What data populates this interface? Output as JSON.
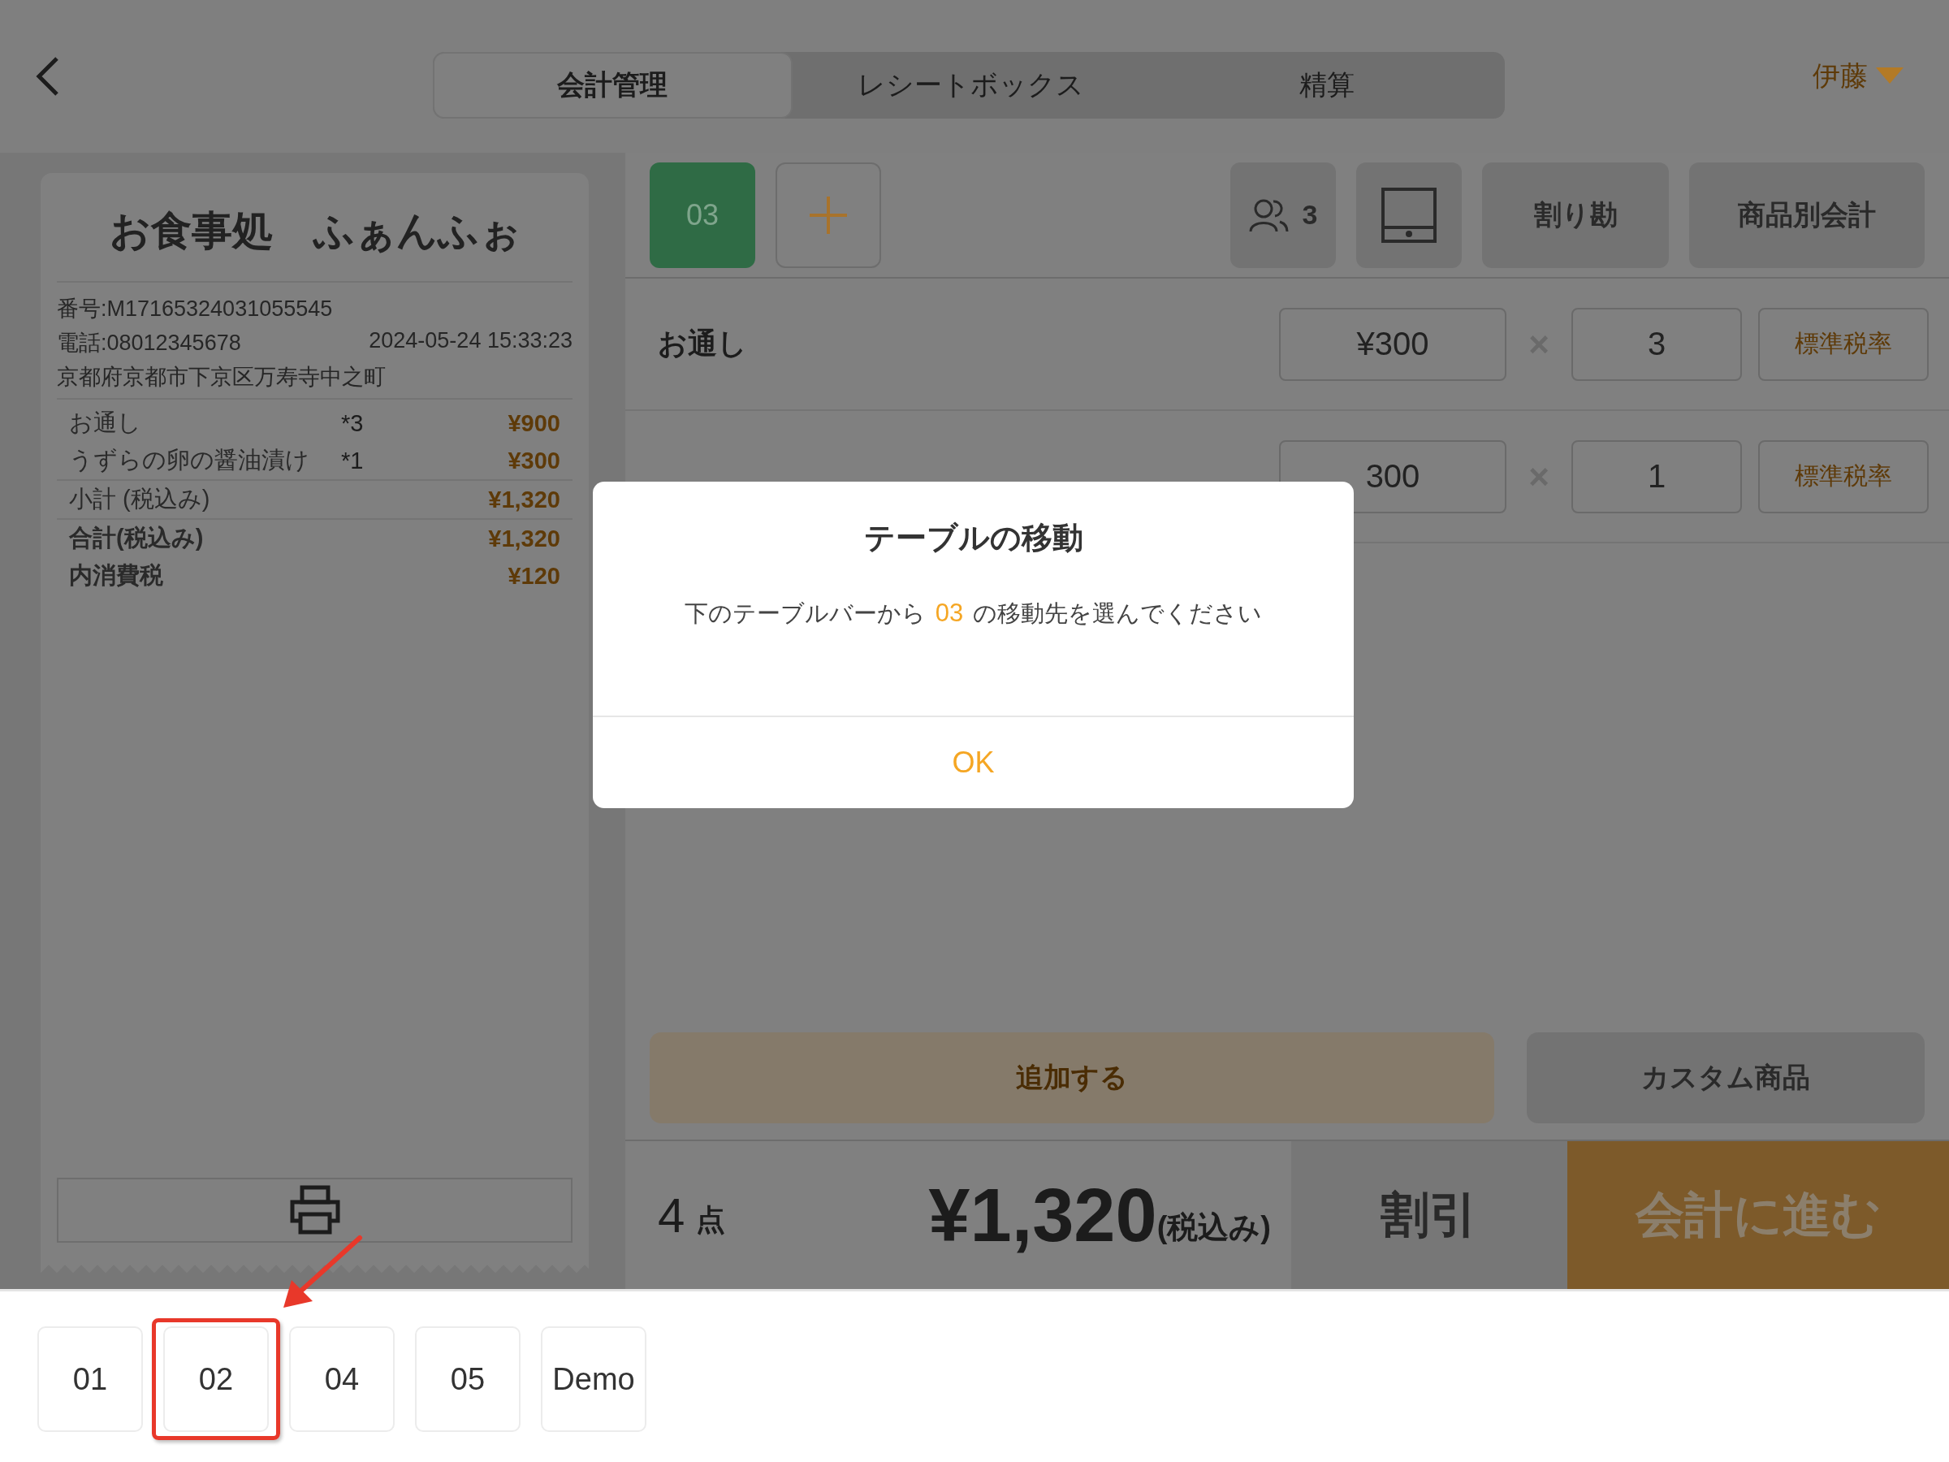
{
  "header": {
    "tabs": [
      {
        "label": "会計管理",
        "selected": true
      },
      {
        "label": "レシートボックス",
        "selected": false
      },
      {
        "label": "精算",
        "selected": false
      }
    ],
    "user": "伊藤"
  },
  "receipt": {
    "shop": "お食事処　ふぁんふぉ",
    "number": "番号:M17165324031055545",
    "phone": "電話:08012345678",
    "datetime": "2024-05-24 15:33:23",
    "address": "京都府京都市下京区万寿寺中之町",
    "items": [
      {
        "name": "お通し",
        "qty": "*3",
        "amount": "¥900"
      },
      {
        "name": "うずらの卵の醤油漬け",
        "qty": "*1",
        "amount": "¥300"
      }
    ],
    "totals": [
      {
        "kind": "subtotal",
        "label": "小計 (税込み)",
        "amount": "¥1,320"
      },
      {
        "kind": "total",
        "label": "合計(税込み)",
        "amount": "¥1,320"
      },
      {
        "kind": "tax",
        "label": "内消費税",
        "amount": "¥120"
      }
    ]
  },
  "toolbar": {
    "table": "03",
    "guests": "3",
    "split": "割り勘",
    "by_item": "商品別会計"
  },
  "order_rows": [
    {
      "name": "お通し",
      "price": "¥300",
      "sign": "×",
      "qty": "3",
      "tax": "標準税率"
    },
    {
      "price": "300",
      "sign": "×",
      "qty": "1",
      "tax": "標準税率"
    }
  ],
  "add_button": "追加する",
  "custom_button": "カスタム商品",
  "summary": {
    "count": "4",
    "unit": "点",
    "total": "¥1,320",
    "tax_note": "(税込み)",
    "discount": "割引",
    "checkout": "会計に進む"
  },
  "dialog": {
    "title": "テーブルの移動",
    "before": "下のテーブルバーから",
    "table": "03",
    "after": "の移動先を選んでください",
    "ok": "OK"
  },
  "table_bar": [
    {
      "label": "01",
      "highlighted": false
    },
    {
      "label": "02",
      "highlighted": true
    },
    {
      "label": "04",
      "highlighted": false
    },
    {
      "label": "05",
      "highlighted": false
    },
    {
      "label": "Demo",
      "highlighted": false
    }
  ]
}
